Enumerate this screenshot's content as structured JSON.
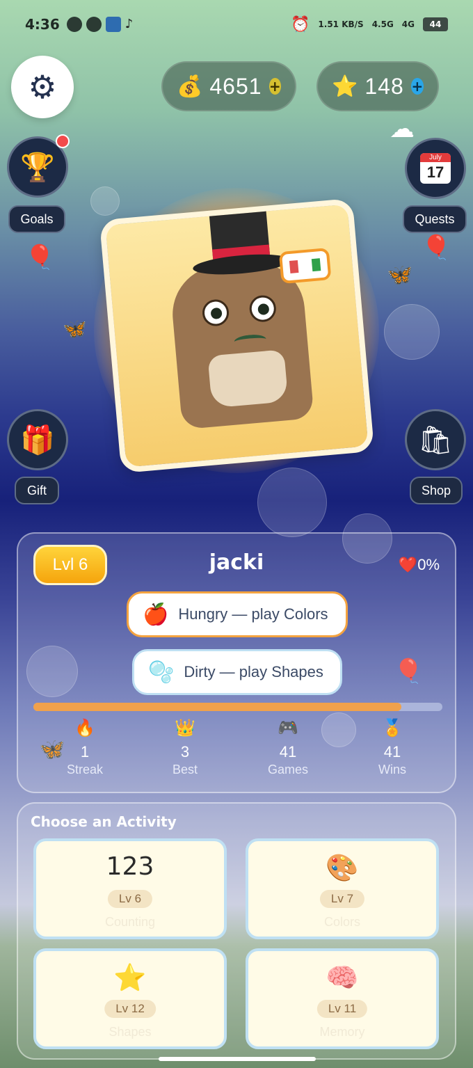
{
  "status_bar": {
    "time": "4:36",
    "speed": "1.51 KB/S",
    "network_1": "4.5G",
    "network_2": "4G",
    "battery": "44"
  },
  "currency": {
    "coins": {
      "icon": "money-bag-icon",
      "value": "4651"
    },
    "stars": {
      "icon": "star-icon",
      "value": "148"
    }
  },
  "side_buttons": {
    "goals": "Goals",
    "quests": "Quests",
    "calendar_month": "July",
    "calendar_day": "17",
    "gift": "Gift",
    "shop": "Shop"
  },
  "pet": {
    "level": "Lvl 6",
    "name": "jacki",
    "affection": "0%",
    "needs": [
      {
        "icon": "apple-icon",
        "text": "Hungry — play Colors"
      },
      {
        "icon": "soap-bubbles-icon",
        "text": "Dirty — play Shapes"
      }
    ],
    "progress": 0.9
  },
  "stats": [
    {
      "icon": "fire-icon",
      "value": "1",
      "label": "Streak"
    },
    {
      "icon": "crown-icon",
      "value": "3",
      "label": "Best"
    },
    {
      "icon": "gamepad-icon",
      "value": "41",
      "label": "Games"
    },
    {
      "icon": "medal-icon",
      "value": "41",
      "label": "Wins"
    }
  ],
  "activities": {
    "title": "Choose an Activity",
    "cards": [
      {
        "icon_text": "123",
        "level": "Lv 6",
        "name": "Counting"
      },
      {
        "icon": "palette-icon",
        "level": "Lv 7",
        "name": "Colors"
      },
      {
        "icon": "star-icon",
        "level": "Lv 12",
        "name": "Shapes"
      },
      {
        "icon": "brain-icon",
        "level": "Lv 11",
        "name": "Memory"
      }
    ]
  },
  "colors": {
    "accent_orange": "#f0a14b",
    "level_gold": "#ffd43b",
    "notification_red": "#f24b4b"
  }
}
